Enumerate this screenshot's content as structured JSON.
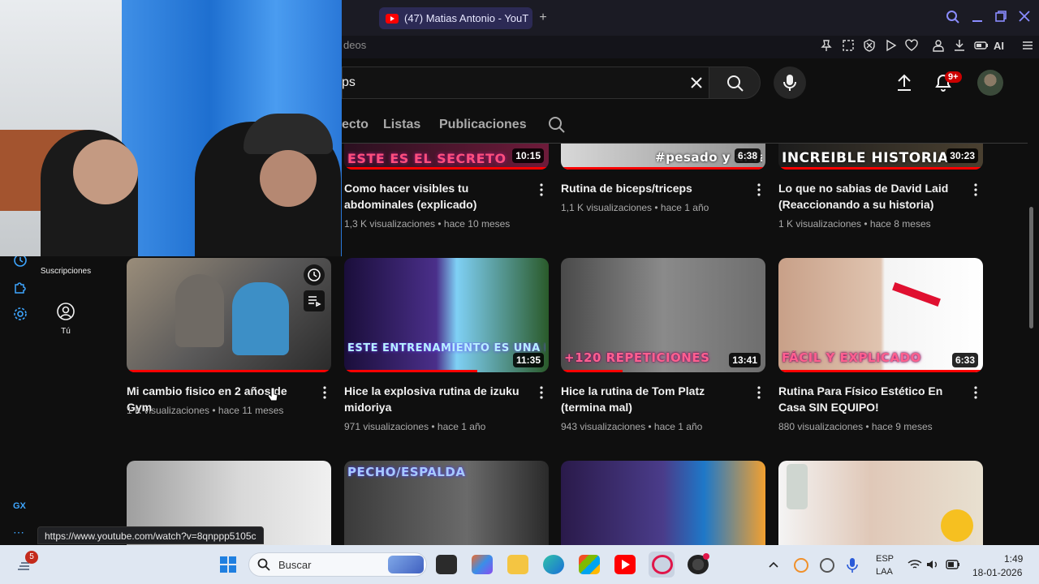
{
  "browser": {
    "tab_title": "(47) Matias Antonio - YouT",
    "address_partial": "deos",
    "ai_label": "AI",
    "status_url": "https://www.youtube.com/watch?v=8qnppp5105c"
  },
  "youtube": {
    "search_value": "ps",
    "notifications_badge": "9+",
    "channel_tabs": [
      "ecto",
      "Listas",
      "Publicaciones"
    ],
    "sidebar": {
      "subscriptions_label": "Suscripciones",
      "you_label": "Tú",
      "gx_label": "GX"
    },
    "videos_row1": [
      {
        "caption": "ESTE ES EL SECRETO",
        "duration": "10:15",
        "title": "Como hacer visibles tu abdominales (explicado)",
        "meta": "1,3 K visualizaciones • hace 10 meses"
      },
      {
        "caption": "#pesado y al fallo",
        "duration": "6:38",
        "title": "Rutina de biceps/triceps",
        "meta": "1,1 K visualizaciones • hace 1 año"
      },
      {
        "caption": "INCREIBLE HISTORIA",
        "duration": "30:23",
        "title": "Lo que no sabias de David Laid (Reaccionando a su historia)",
        "meta": "1 K visualizaciones • hace 8 meses"
      }
    ],
    "videos_row2": [
      {
        "caption": "",
        "duration": "",
        "title": "Mi cambio fisico en 2 años de Gym",
        "meta": "1 K visualizaciones • hace 11 meses"
      },
      {
        "caption": "ESTE ENTRENAMIENTO ES UNA LOCURA",
        "duration": "11:35",
        "title": "Hice la explosiva rutina de izuku midoriya",
        "meta": "971 visualizaciones • hace 1 año"
      },
      {
        "caption": "+120 REPETICIONES",
        "duration": "13:41",
        "title": "Hice la rutina de Tom Platz (termina mal)",
        "meta": "943 visualizaciones • hace 1 año"
      },
      {
        "caption": "FÁCIL Y EXPLICADO",
        "duration": "6:33",
        "title": "Rutina Para Físico Estético En Casa SIN EQUIPO!",
        "meta": "880 visualizaciones • hace 9 meses"
      }
    ],
    "videos_row3": [
      {
        "caption": ""
      },
      {
        "caption": "PECHO/ESPALDA"
      },
      {
        "caption": ""
      },
      {
        "caption": ""
      }
    ]
  },
  "taskbar": {
    "notification_count": "5",
    "search_placeholder": "Buscar",
    "lang_line1": "ESP",
    "lang_line2": "LAA",
    "time": "1:49",
    "date": "18-01-2026"
  },
  "colors": {
    "yt_red": "#ff0000",
    "accent_blue": "#3ea6ff",
    "opera_purple": "#8a8cff"
  }
}
